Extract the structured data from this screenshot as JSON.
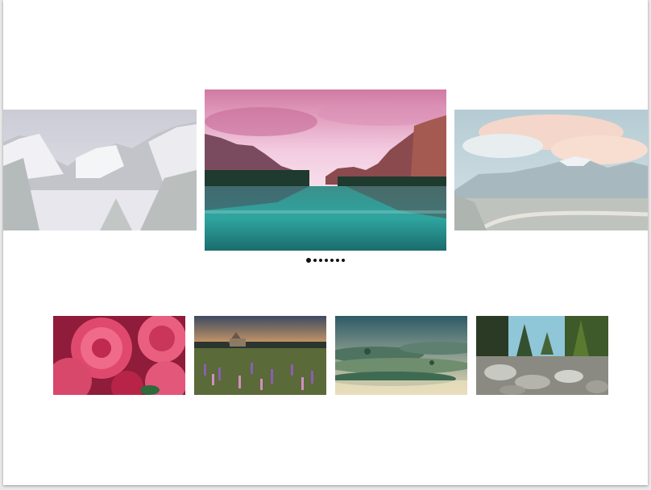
{
  "carousel": {
    "slides": [
      {
        "subject": "snowy-valley"
      },
      {
        "subject": "mountain-lake-pink-sky"
      },
      {
        "subject": "cloudy-mountain-road"
      }
    ],
    "dots": 7,
    "active_dot": 0
  },
  "thumbnails": [
    {
      "subject": "pink-dahlia-flowers"
    },
    {
      "subject": "church-lupine-field"
    },
    {
      "subject": "misty-green-hills"
    },
    {
      "subject": "rocky-forest-stream"
    }
  ]
}
